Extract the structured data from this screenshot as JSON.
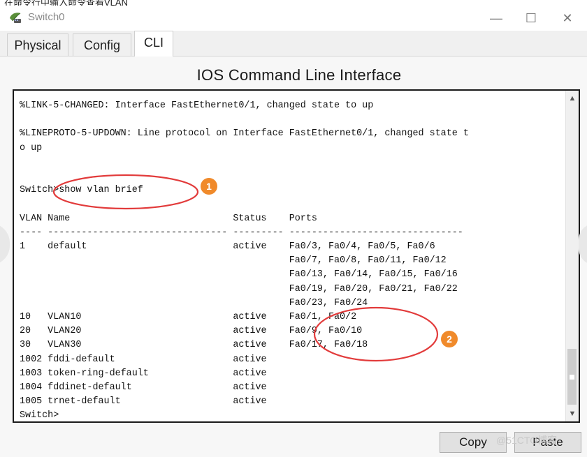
{
  "window": {
    "title": "Switch0",
    "minimize_glyph": "—",
    "maximize_glyph": "☐",
    "close_glyph": "✕",
    "top_clip_text": "在命令行中输入命令查看VLAN"
  },
  "tabs": [
    {
      "label": "Physical"
    },
    {
      "label": "Config"
    },
    {
      "label": "CLI",
      "active": true
    }
  ],
  "cli": {
    "heading": "IOS Command Line Interface",
    "output": "%LINK-5-CHANGED: Interface FastEthernet0/1, changed state to up\n\n%LINEPROTO-5-UPDOWN: Line protocol on Interface FastEthernet0/1, changed state t\no up\n\n\nSwitch>show vlan brief\n\nVLAN Name                             Status    Ports\n---- -------------------------------- --------- -------------------------------\n1    default                          active    Fa0/3, Fa0/4, Fa0/5, Fa0/6\n                                                Fa0/7, Fa0/8, Fa0/11, Fa0/12\n                                                Fa0/13, Fa0/14, Fa0/15, Fa0/16\n                                                Fa0/19, Fa0/20, Fa0/21, Fa0/22\n                                                Fa0/23, Fa0/24\n10   VLAN10                           active    Fa0/1, Fa0/2\n20   VLAN20                           active    Fa0/9, Fa0/10\n30   VLAN30                           active    Fa0/17, Fa0/18\n1002 fddi-default                     active    \n1003 token-ring-default               active    \n1004 fddinet-default                  active    \n1005 trnet-default                    active    \nSwitch>"
  },
  "buttons": {
    "copy": "Copy",
    "paste": "Paste"
  },
  "annotations": [
    {
      "number": "1"
    },
    {
      "number": "2"
    }
  ],
  "watermark": "@51CTO博客",
  "icons": {
    "app": "switch-icon",
    "scroll_up": "chevron-up-icon",
    "scroll_down": "chevron-down-icon"
  },
  "colors": {
    "annotation_ring": "#e23b3b",
    "annotation_badge": "#f08a2b"
  }
}
